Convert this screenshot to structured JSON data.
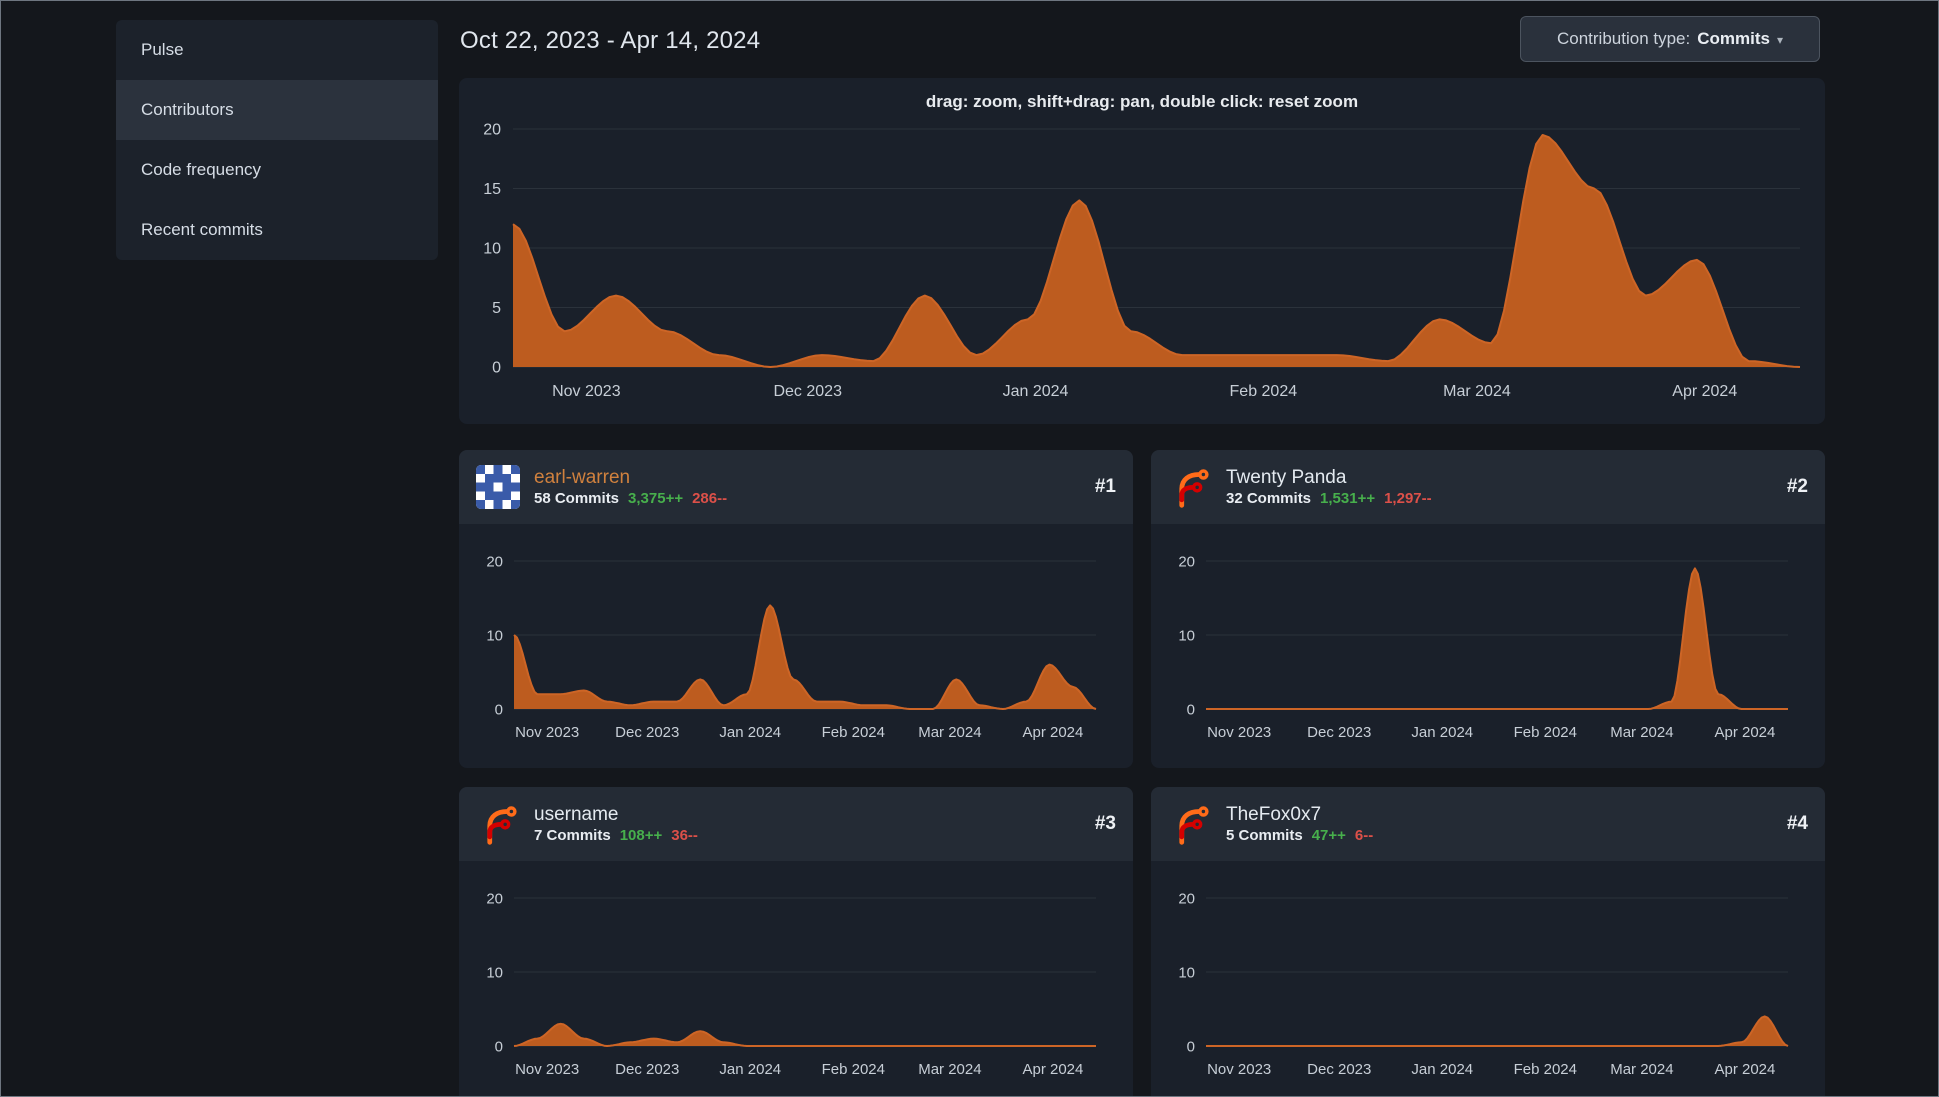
{
  "page": {
    "title_date_range": "Oct 22, 2023 - Apr 14, 2024"
  },
  "sidebar": {
    "items": [
      {
        "label": "Pulse",
        "active": false
      },
      {
        "label": "Contributors",
        "active": true
      },
      {
        "label": "Code frequency",
        "active": false
      },
      {
        "label": "Recent commits",
        "active": false
      }
    ]
  },
  "toolbar": {
    "contribution_type_label": "Contribution type:",
    "contribution_type_value": "Commits"
  },
  "colors": {
    "area_fill": "#bd5c1f",
    "area_stroke": "#cd6526",
    "additions_green": "#47af4c",
    "deletions_red": "#dc5049",
    "grid": "#2b323b",
    "axis_text": "#c7ced6",
    "panel_bg": "#1a202a",
    "card_header_bg": "#242b35"
  },
  "chart_data": [
    {
      "id": "main",
      "type": "area",
      "title": "Overall commits",
      "hint": "drag: zoom, shift+drag: pan, double click: reset zoom",
      "x_weeks": [
        "2023-10-22",
        "2023-10-29",
        "2023-11-05",
        "2023-11-12",
        "2023-11-19",
        "2023-11-26",
        "2023-12-03",
        "2023-12-10",
        "2023-12-17",
        "2023-12-24",
        "2023-12-31",
        "2024-01-07",
        "2024-01-14",
        "2024-01-21",
        "2024-01-28",
        "2024-02-04",
        "2024-02-11",
        "2024-02-18",
        "2024-02-25",
        "2024-03-03",
        "2024-03-10",
        "2024-03-17",
        "2024-03-24",
        "2024-03-31",
        "2024-04-07",
        "2024-04-14"
      ],
      "x_axis_labels": [
        "Nov 2023",
        "Dec 2023",
        "Jan 2024",
        "Feb 2024",
        "Mar 2024",
        "Apr 2024"
      ],
      "x_label_fractions": [
        0.057,
        0.229,
        0.406,
        0.583,
        0.749,
        0.926
      ],
      "ylim": [
        0,
        20
      ],
      "yticks": [
        0,
        5,
        10,
        15,
        20
      ],
      "grid_lines": "horizontal",
      "values": [
        12,
        3,
        6,
        3,
        1,
        0,
        1,
        0.5,
        6,
        1,
        4,
        14,
        3,
        1,
        1,
        1,
        1,
        0.5,
        4,
        2,
        19.5,
        15,
        6,
        9,
        0.5,
        0
      ]
    },
    {
      "id": "contributor-1",
      "type": "area",
      "title": "earl-warren",
      "ylim": [
        0,
        20
      ],
      "yticks": [
        0,
        10,
        20
      ],
      "values": [
        10,
        2,
        2,
        2.5,
        1,
        0.5,
        1,
        1,
        4,
        0.5,
        2,
        14,
        4,
        1,
        1,
        0.5,
        0.5,
        0,
        0,
        4,
        0.5,
        0,
        1,
        6,
        3,
        0
      ]
    },
    {
      "id": "contributor-2",
      "type": "area",
      "title": "Twenty Panda",
      "ylim": [
        0,
        20
      ],
      "yticks": [
        0,
        10,
        20
      ],
      "values": [
        0,
        0,
        0,
        0,
        0,
        0,
        0,
        0,
        0,
        0,
        0,
        0,
        0,
        0,
        0,
        0,
        0,
        0,
        0,
        0,
        1,
        19,
        2,
        0,
        0,
        0
      ]
    },
    {
      "id": "contributor-3",
      "type": "area",
      "title": "username",
      "ylim": [
        0,
        20
      ],
      "yticks": [
        0,
        10,
        20
      ],
      "values": [
        0,
        1,
        3,
        1,
        0,
        0.5,
        1,
        0.5,
        2,
        0.5,
        0,
        0,
        0,
        0,
        0,
        0,
        0,
        0,
        0,
        0,
        0,
        0,
        0,
        0,
        0,
        0
      ]
    },
    {
      "id": "contributor-4",
      "type": "area",
      "title": "TheFox0x7",
      "ylim": [
        0,
        20
      ],
      "yticks": [
        0,
        10,
        20
      ],
      "values": [
        0,
        0,
        0,
        0,
        0,
        0,
        0,
        0,
        0,
        0,
        0,
        0,
        0,
        0,
        0,
        0,
        0,
        0,
        0,
        0,
        0,
        0,
        0,
        0.5,
        4,
        0
      ]
    }
  ],
  "contributors": [
    {
      "rank": "#1",
      "name": "earl-warren",
      "name_color": "#d0813e",
      "avatar": "identicon",
      "commits": "58 Commits",
      "additions": "3,375++",
      "deletions": "286--"
    },
    {
      "rank": "#2",
      "name": "Twenty Panda",
      "name_color": "#e4eaf0",
      "avatar": "forgejo-logo",
      "commits": "32 Commits",
      "additions": "1,531++",
      "deletions": "1,297--"
    },
    {
      "rank": "#3",
      "name": "username",
      "name_color": "#e4eaf0",
      "avatar": "forgejo-logo",
      "commits": "7 Commits",
      "additions": "108++",
      "deletions": "36--"
    },
    {
      "rank": "#4",
      "name": "TheFox0x7",
      "name_color": "#e4eaf0",
      "avatar": "forgejo-logo",
      "commits": "5 Commits",
      "additions": "47++",
      "deletions": "6--"
    }
  ]
}
